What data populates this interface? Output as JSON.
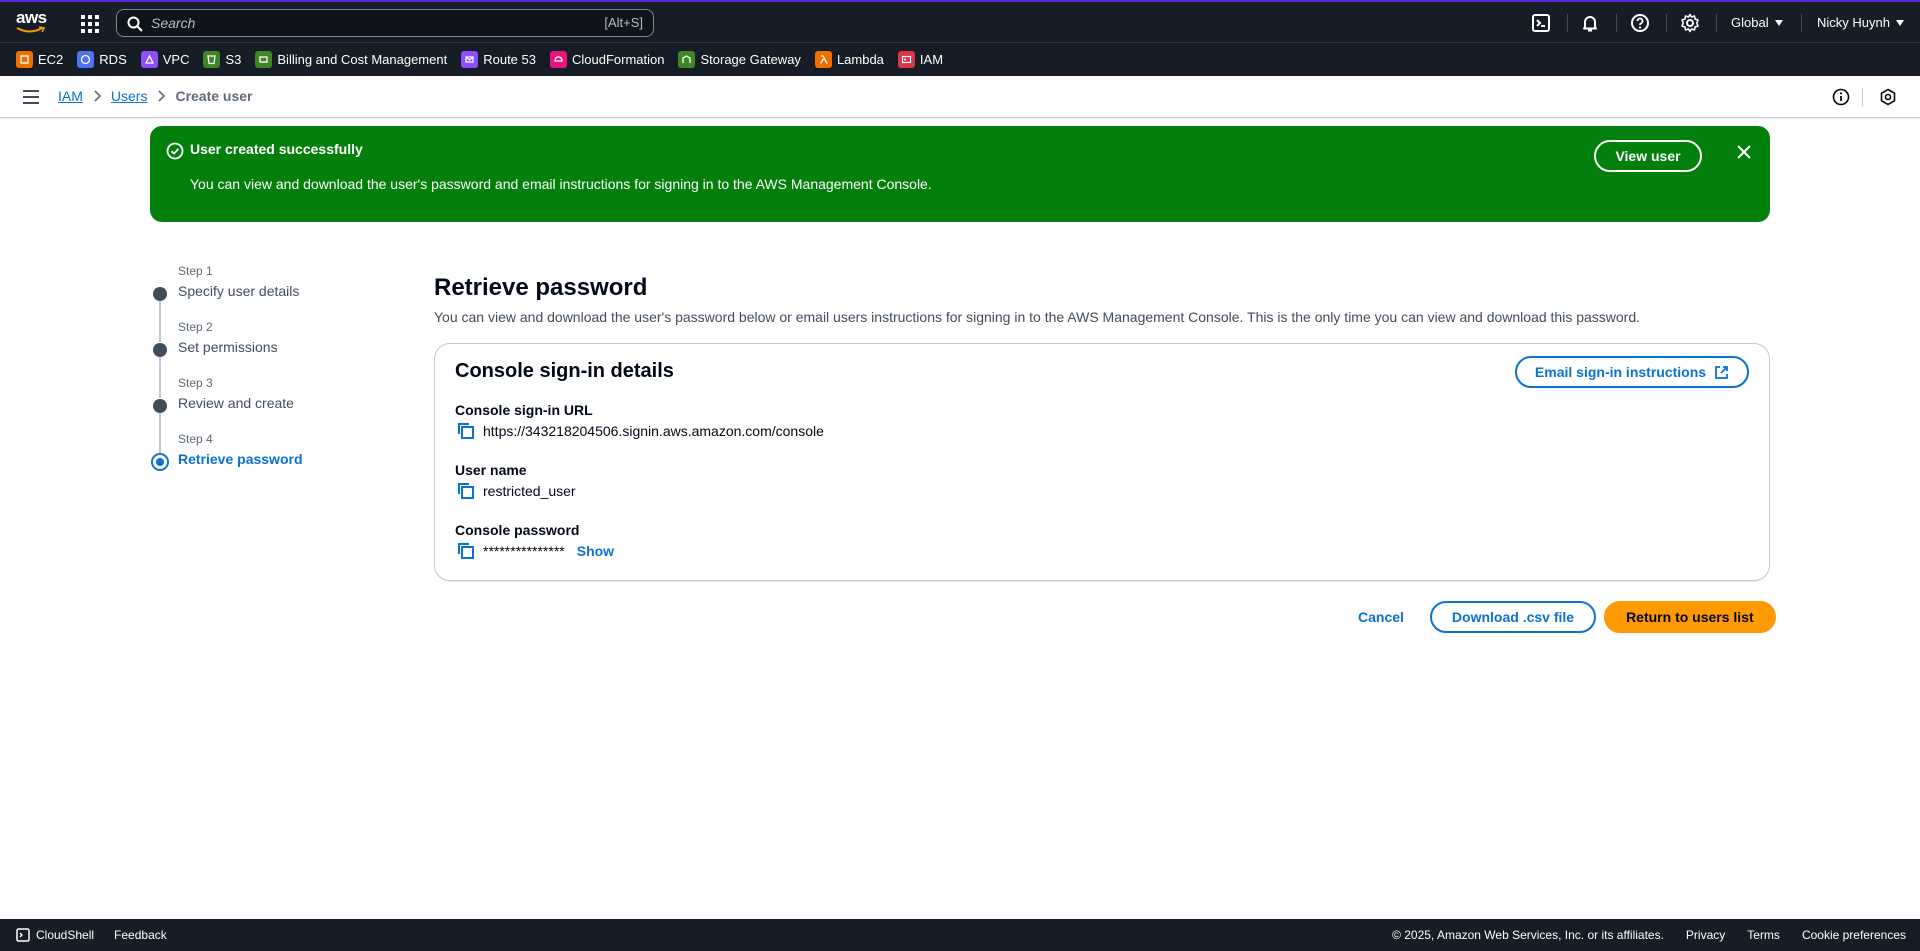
{
  "topnav": {
    "logo_text": "aws",
    "search_placeholder": "Search",
    "search_shortcut": "[Alt+S]",
    "region": "Global",
    "user": "Nicky Huynh"
  },
  "favorites": [
    {
      "label": "EC2",
      "color": "#ed7100"
    },
    {
      "label": "RDS",
      "color": "#4d72f3"
    },
    {
      "label": "VPC",
      "color": "#8c4fff"
    },
    {
      "label": "S3",
      "color": "#3f8624"
    },
    {
      "label": "Billing and Cost Management",
      "color": "#3f8624"
    },
    {
      "label": "Route 53",
      "color": "#8c4fff"
    },
    {
      "label": "CloudFormation",
      "color": "#e7157b"
    },
    {
      "label": "Storage Gateway",
      "color": "#3f8624"
    },
    {
      "label": "Lambda",
      "color": "#ed7100"
    },
    {
      "label": "IAM",
      "color": "#dd344c"
    }
  ],
  "breadcrumb": {
    "items": [
      "IAM",
      "Users"
    ],
    "current": "Create user"
  },
  "flash": {
    "title": "User created successfully",
    "message": "You can view and download the user's password and email instructions for signing in to the AWS Management Console.",
    "action": "View user"
  },
  "steps": [
    {
      "num": "Step 1",
      "label": "Specify user details"
    },
    {
      "num": "Step 2",
      "label": "Set permissions"
    },
    {
      "num": "Step 3",
      "label": "Review and create"
    },
    {
      "num": "Step 4",
      "label": "Retrieve password"
    }
  ],
  "main": {
    "title": "Retrieve password",
    "description": "You can view and download the user's password below or email users instructions for signing in to the AWS Management Console. This is the only time you can view and download this password.",
    "card": {
      "title": "Console sign-in details",
      "email_button": "Email sign-in instructions",
      "fields": [
        {
          "label": "Console sign-in URL",
          "value": "https://343218204506.signin.aws.amazon.com/console"
        },
        {
          "label": "User name",
          "value": "restricted_user"
        },
        {
          "label": "Console password",
          "value": "***************",
          "show_label": "Show"
        }
      ]
    },
    "actions": {
      "cancel": "Cancel",
      "download": "Download .csv file",
      "return": "Return to users list"
    }
  },
  "footer": {
    "cloudshell": "CloudShell",
    "feedback": "Feedback",
    "copyright": "© 2025, Amazon Web Services, Inc. or its affiliates.",
    "privacy": "Privacy",
    "terms": "Terms",
    "cookies": "Cookie preferences"
  },
  "colors": {
    "nav_bg": "#161d26",
    "success": "#037f0c",
    "link": "#0972d3",
    "primary_button": "#ff9900"
  }
}
